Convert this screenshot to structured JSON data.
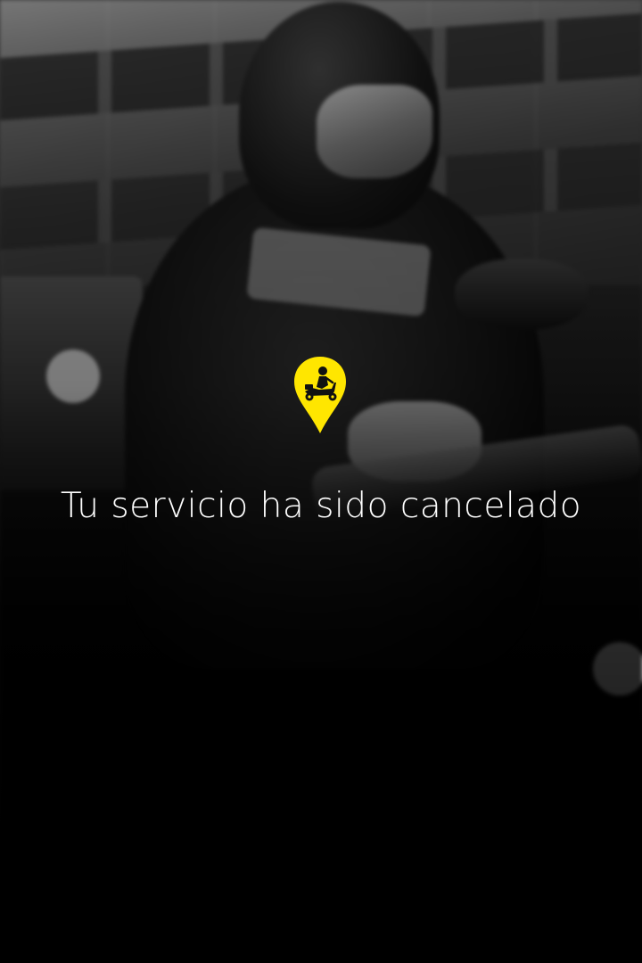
{
  "status": {
    "message": "Tu servicio ha sido cancelado",
    "icon": "scooter-delivery-pin-icon"
  },
  "background": {
    "photo": "blurred-grayscale-motorcycle-rider"
  },
  "colors": {
    "accent_yellow": "#FFE600",
    "text": "#FFFFFF",
    "overlay": "#000000"
  }
}
